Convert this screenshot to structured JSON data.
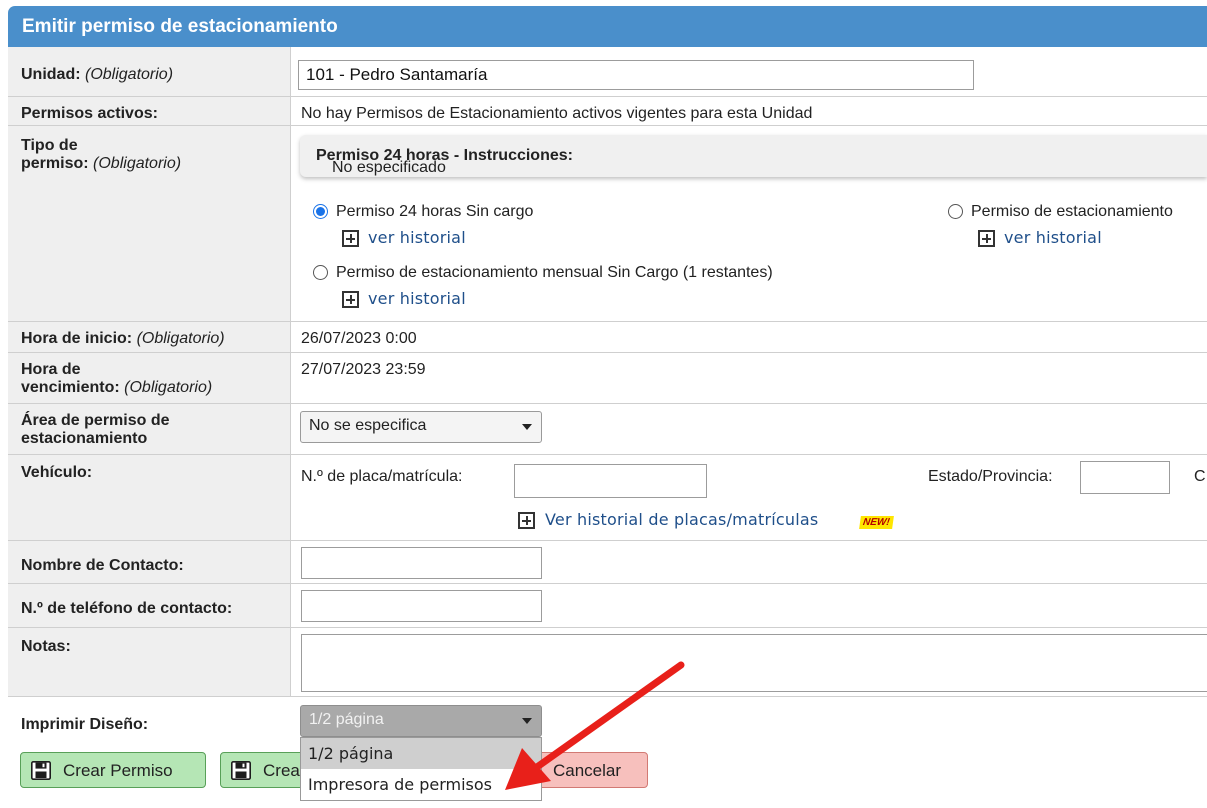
{
  "header": {
    "title": "Emitir permiso de estacionamiento"
  },
  "labels": {
    "required": "(Obligatorio)",
    "unit": "Unidad:",
    "active_permits": "Permisos activos:",
    "permit_type_line1": "Tipo de",
    "permit_type_line2": "permiso:",
    "start_time": "Hora de inicio:",
    "expiry_line1": "Hora de",
    "expiry_line2": "vencimiento:",
    "area_line1": "Área de permiso de",
    "area_line2": "estacionamiento",
    "vehicle": "Vehículo:",
    "contact_name": "Nombre de Contacto:",
    "contact_phone": "N.º de teléfono de contacto:",
    "notes": "Notas:",
    "print_design": "Imprimir Diseño:"
  },
  "unit": {
    "value": "101 - Pedro Santamaría"
  },
  "active_permits": {
    "text": "No hay Permisos de Estacionamiento activos vigentes para esta Unidad"
  },
  "instructions": {
    "title": "Permiso 24 horas - Instrucciones:",
    "value": "No especificado"
  },
  "permit_options": [
    {
      "label": "Permiso 24 horas Sin cargo",
      "selected": true,
      "history": "ver historial"
    },
    {
      "label": "Permiso de estacionamiento",
      "selected": false,
      "history": "ver historial"
    },
    {
      "label": "Permiso de estacionamiento mensual Sin Cargo (1 restantes)",
      "selected": false,
      "history": "ver historial"
    }
  ],
  "times": {
    "start": "26/07/2023 0:00",
    "expiry": "27/07/2023 23:59"
  },
  "area": {
    "selected": "No se especifica"
  },
  "vehicle": {
    "plate_label": "N.º de placa/matrícula:",
    "plate_value": "",
    "state_label": "Estado/Provincia:",
    "state_value": "",
    "cut_label": "C",
    "history_link": "Ver historial de placas/matrículas",
    "new_badge": "NEW!"
  },
  "contact": {
    "name": "",
    "phone": ""
  },
  "notes": {
    "value": ""
  },
  "print": {
    "selected": "1/2 página",
    "options": [
      "1/2 página",
      "Impresora de permisos"
    ]
  },
  "buttons": {
    "create": "Crear Permiso",
    "create2": "Crea",
    "cancel": "Cancelar"
  },
  "colors": {
    "header": "#4a8fcb",
    "link": "#1f4f8a",
    "arrow": "#e8201a"
  }
}
